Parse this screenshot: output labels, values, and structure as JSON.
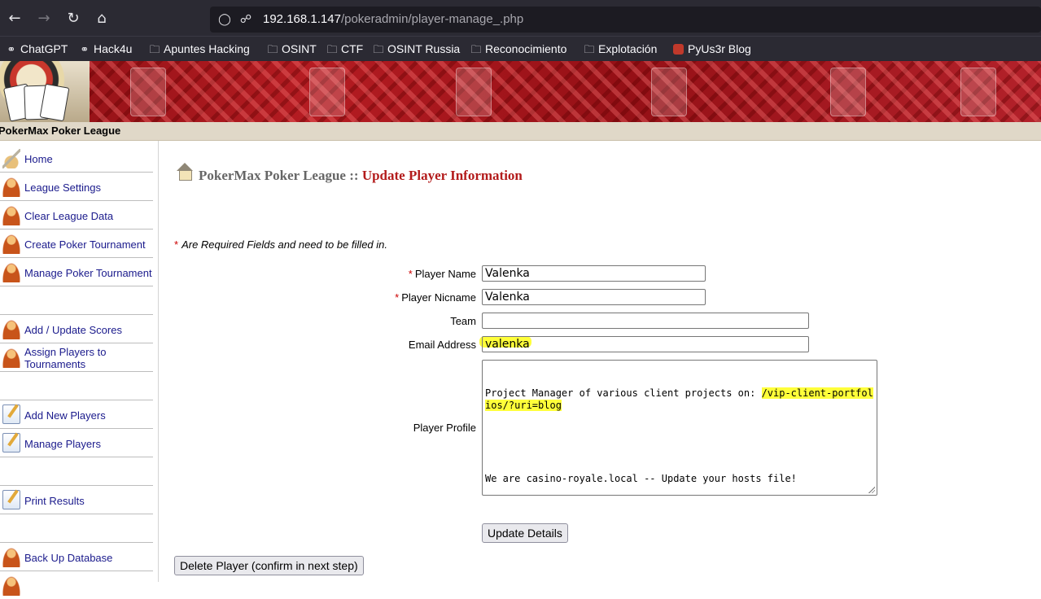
{
  "browser": {
    "url_host": "192.168.1.147",
    "url_path": "/pokeradmin/player-manage_.php",
    "icons": {
      "back": "arrow-left-icon",
      "forward": "arrow-right-icon",
      "reload": "reload-icon",
      "home": "home-icon",
      "shield": "shield-icon",
      "insecure": "lock-slash-icon"
    }
  },
  "bookmarks": [
    {
      "label": "ChatGPT",
      "icon": "globe-icon"
    },
    {
      "label": "Hack4u",
      "icon": "globe-icon"
    },
    {
      "label": "Apuntes Hacking",
      "icon": "folder-icon"
    },
    {
      "label": "OSINT",
      "icon": "folder-icon"
    },
    {
      "label": "CTF",
      "icon": "folder-icon"
    },
    {
      "label": "OSINT Russia",
      "icon": "folder-icon"
    },
    {
      "label": "Reconocimiento",
      "icon": "folder-icon"
    },
    {
      "label": "Explotación",
      "icon": "folder-icon"
    },
    {
      "label": "PyUs3r Blog",
      "icon": "site-favicon"
    }
  ],
  "league_name": "PokerMax Poker League",
  "sidebar": {
    "items": [
      {
        "label": "Home",
        "icon": "house-icon"
      },
      {
        "label": "League Settings",
        "icon": "user-icon"
      },
      {
        "label": "Clear League Data",
        "icon": "user-icon"
      },
      {
        "label": "Create Poker Tournament",
        "icon": "user-icon"
      },
      {
        "label": "Manage Poker Tournament",
        "icon": "user-icon"
      },
      {
        "label": "Add / Update Scores",
        "icon": "user-icon"
      },
      {
        "label": "Assign Players to Tournaments",
        "icon": "user-icon"
      },
      {
        "label": "Add New Players",
        "icon": "notepad-icon"
      },
      {
        "label": "Manage Players",
        "icon": "notepad-icon"
      },
      {
        "label": "Print Results",
        "icon": "notepad-icon"
      },
      {
        "label": "Back Up Database",
        "icon": "user-icon"
      }
    ]
  },
  "page": {
    "title_app": "PokerMax Poker League ::",
    "title_page": "Update Player Information",
    "required_star": "*",
    "required_note": "Are Required Fields and need to be filled in."
  },
  "form": {
    "player_name": {
      "label": "Player Name",
      "value": "Valenka",
      "required": true
    },
    "player_nickname": {
      "label": "Player Nicname",
      "value": "Valenka",
      "required": true
    },
    "team": {
      "label": "Team",
      "value": ""
    },
    "email": {
      "label": "Email Address",
      "value": "valenka"
    },
    "profile": {
      "label": "Player Profile",
      "line1_prefix": "Project Manager of various client projects on: ",
      "line1_highlight": "/vip-client-portfolios/?uri=blog",
      "line2": "We are casino-royale.local -- Update your hosts file!"
    }
  },
  "buttons": {
    "update": "Update Details",
    "delete": "Delete Player (confirm in next step)"
  },
  "colors": {
    "title_red": "#b31b1b",
    "title_gray": "#666666",
    "highlight": "#ffff3a",
    "link": "#1a1a8c"
  }
}
